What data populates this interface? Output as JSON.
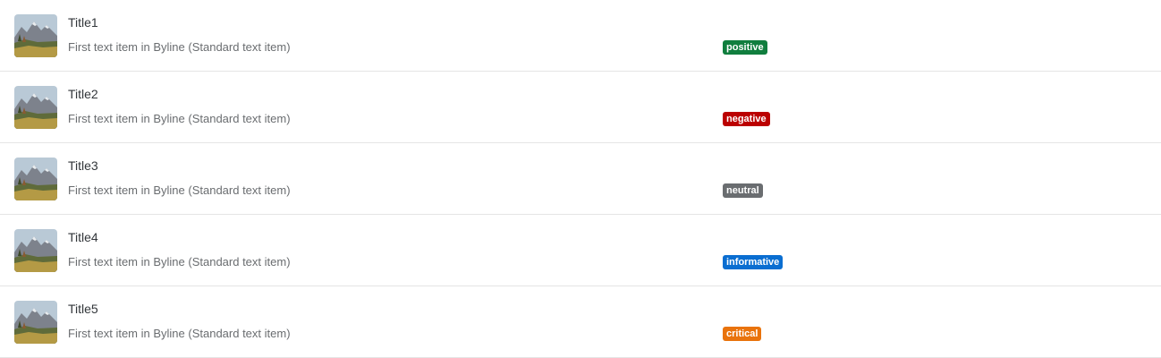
{
  "items": [
    {
      "title": "Title1",
      "byline": "First text item in Byline (Standard text item)",
      "status": "positive",
      "image": "mountain-landscape-thumbnail"
    },
    {
      "title": "Title2",
      "byline": "First text item in Byline (Standard text item)",
      "status": "negative",
      "image": "mountain-landscape-thumbnail"
    },
    {
      "title": "Title3",
      "byline": "First text item in Byline (Standard text item)",
      "status": "neutral",
      "image": "mountain-landscape-thumbnail"
    },
    {
      "title": "Title4",
      "byline": "First text item in Byline (Standard text item)",
      "status": "informative",
      "image": "mountain-landscape-thumbnail"
    },
    {
      "title": "Title5",
      "byline": "First text item in Byline (Standard text item)",
      "status": "critical",
      "image": "mountain-landscape-thumbnail"
    }
  ],
  "status_colors": {
    "positive": "#107e3e",
    "negative": "#bb0000",
    "neutral": "#6a6d70",
    "informative": "#0a6ed1",
    "critical": "#e9730c"
  }
}
